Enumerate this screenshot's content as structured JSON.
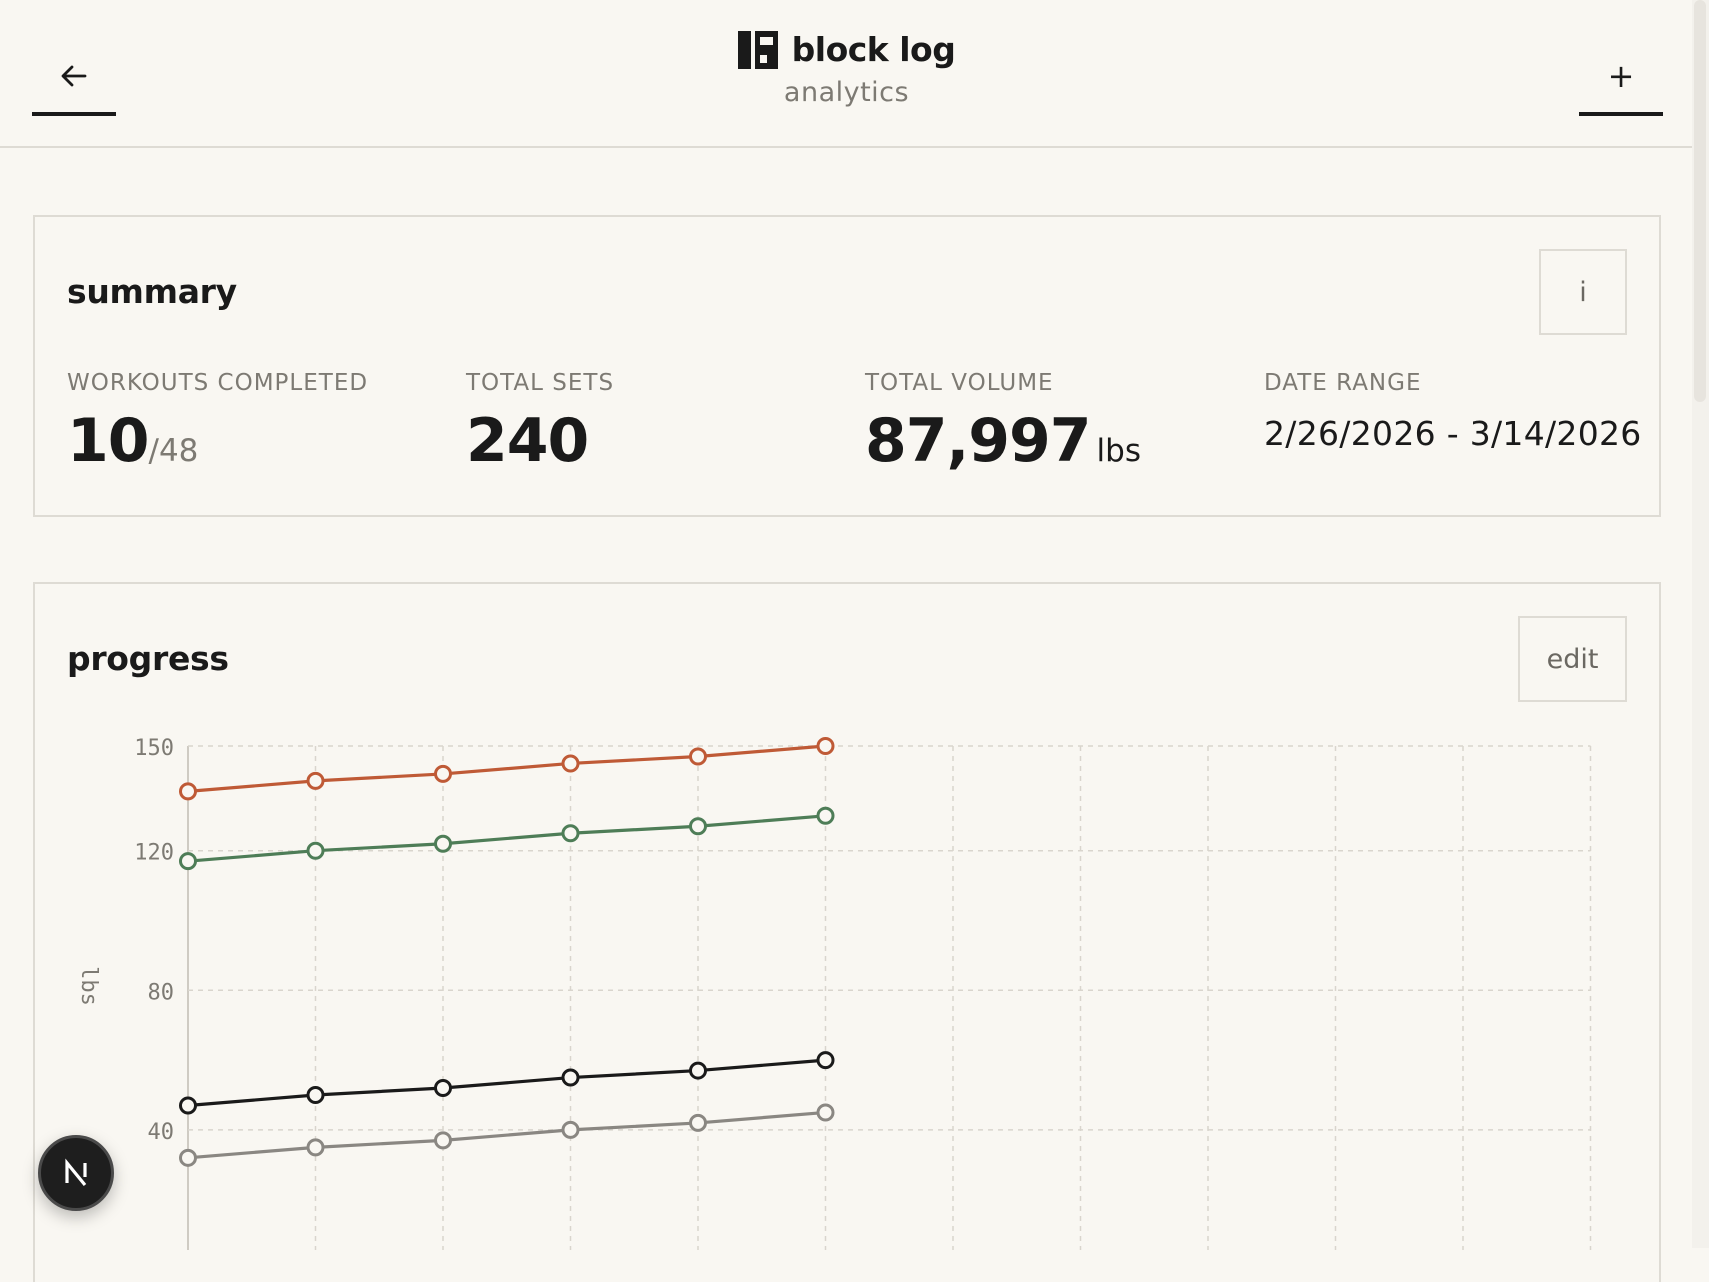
{
  "header": {
    "brand_name": "block log",
    "subtitle": "analytics",
    "back_icon": "arrow-left-icon",
    "add_label": "+"
  },
  "summary": {
    "title": "summary",
    "info_label": "i",
    "stats": {
      "workouts": {
        "label": "WORKOUTS COMPLETED",
        "value": "10",
        "total": "/48"
      },
      "sets": {
        "label": "TOTAL SETS",
        "value": "240"
      },
      "volume": {
        "label": "TOTAL VOLUME",
        "value": "87,997",
        "unit": "lbs"
      },
      "range": {
        "label": "DATE RANGE",
        "value": "2/26/2026 - 3/14/2026"
      }
    }
  },
  "progress": {
    "title": "progress",
    "edit_label": "edit"
  },
  "colors": {
    "background": "#f9f7f2",
    "border": "#dedbd4",
    "text": "#1a1a1a",
    "muted": "#7d7a73",
    "grid": "#d9d5cd"
  },
  "chart_data": {
    "type": "line",
    "ylabel": "lbs",
    "yticks": [
      40,
      80,
      120,
      150
    ],
    "ylim": [
      0,
      150
    ],
    "x_slots": 12,
    "grid": true,
    "series": [
      {
        "color": "#bf5a36",
        "x": [
          0,
          1,
          2,
          3,
          4,
          5
        ],
        "values": [
          137,
          140,
          142,
          145,
          147,
          150
        ]
      },
      {
        "color": "#4e7d57",
        "x": [
          0,
          1,
          2,
          3,
          4,
          5
        ],
        "values": [
          117,
          120,
          122,
          125,
          127,
          130
        ]
      },
      {
        "color": "#1a1a1a",
        "x": [
          0,
          1,
          2,
          3,
          4,
          5
        ],
        "values": [
          47,
          50,
          52,
          55,
          57,
          60
        ]
      },
      {
        "color": "#8a8782",
        "x": [
          0,
          1,
          2,
          3,
          4,
          5
        ],
        "values": [
          32,
          35,
          37,
          40,
          42,
          45
        ]
      }
    ]
  },
  "fab": {
    "icon": "nextjs-logo-icon",
    "letter": "N"
  }
}
